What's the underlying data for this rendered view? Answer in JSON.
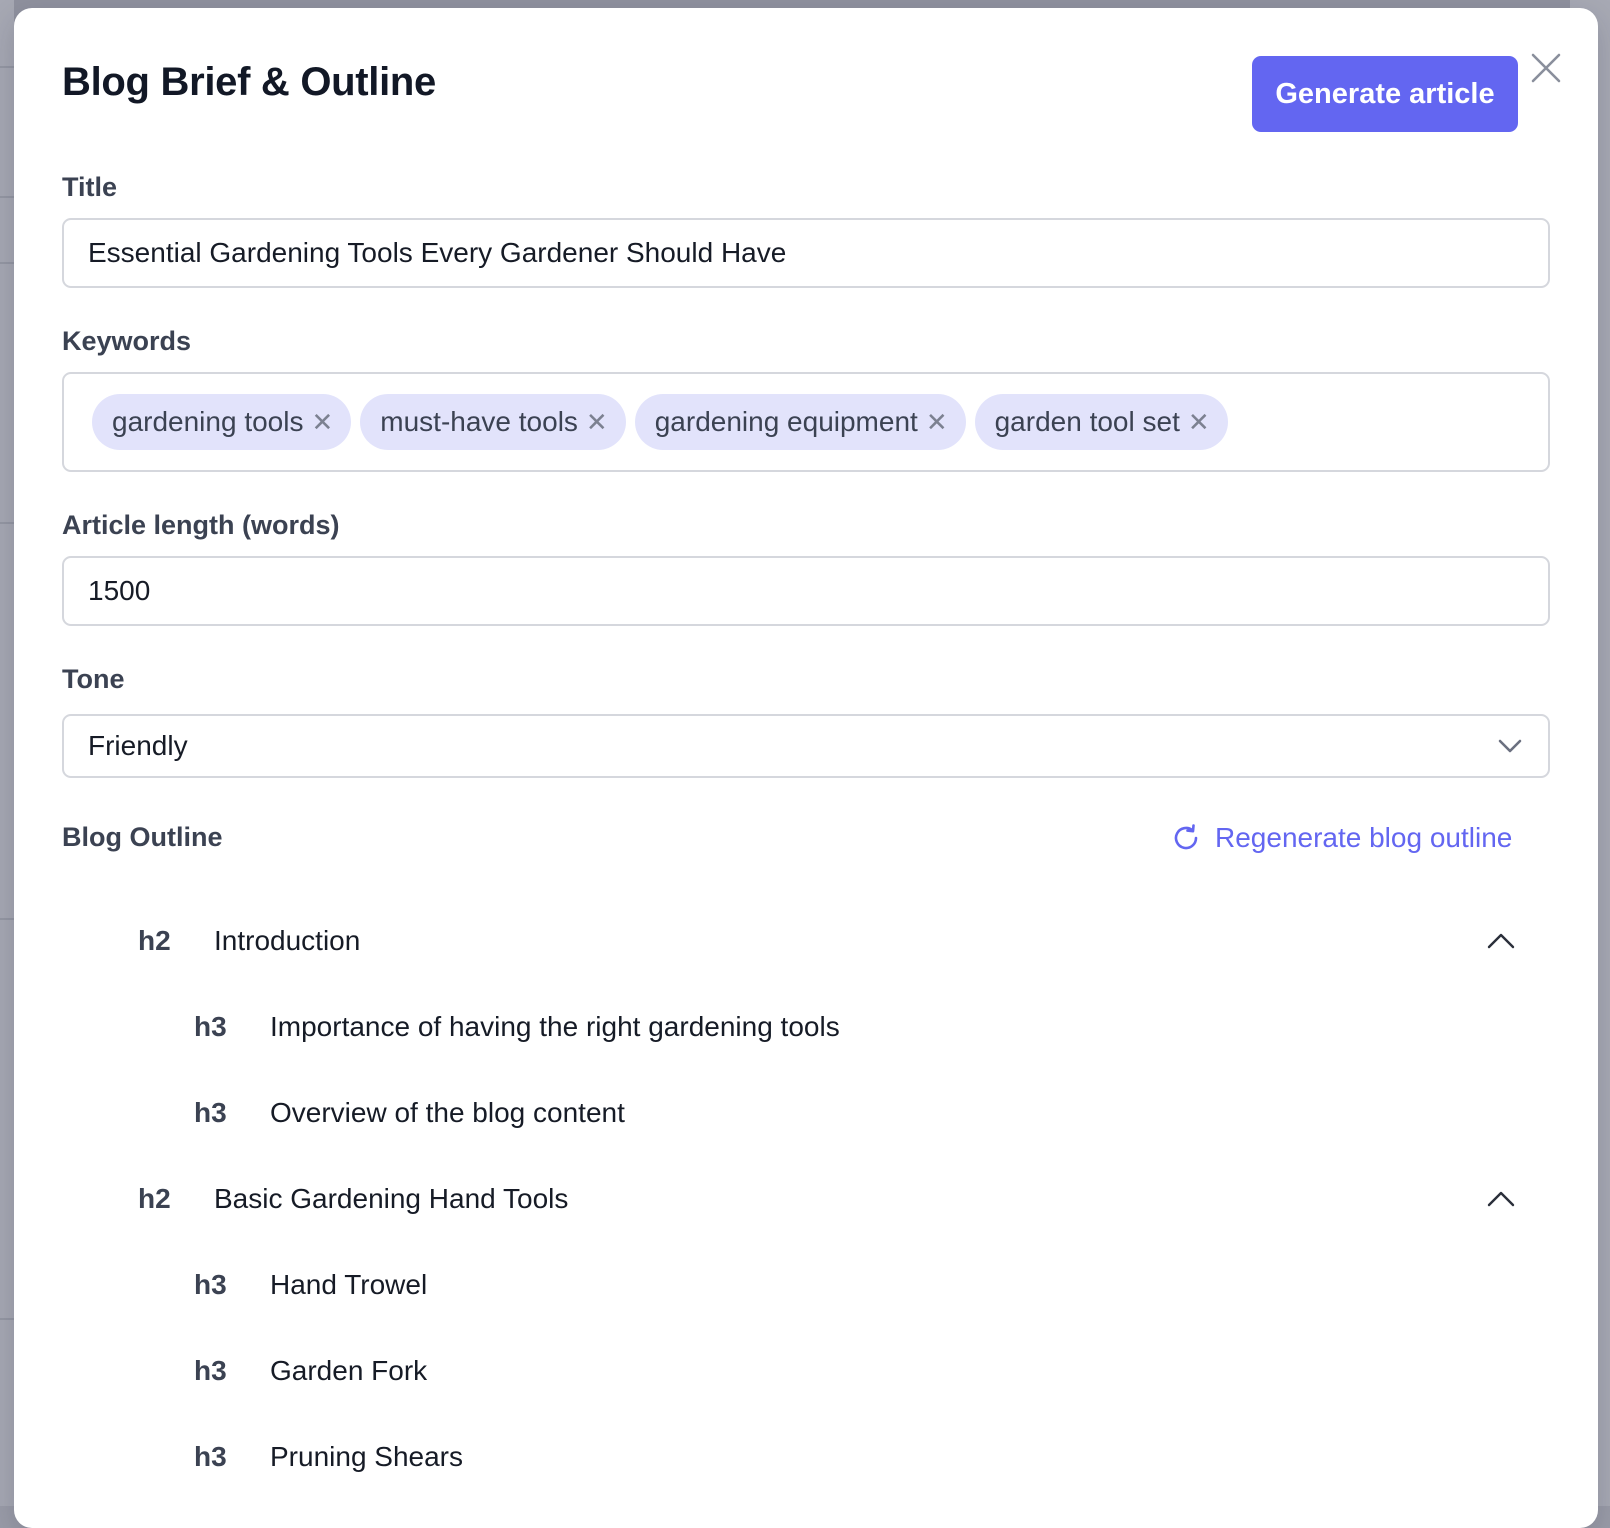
{
  "modal": {
    "title": "Blog Brief & Outline",
    "generate_label": "Generate article"
  },
  "fields": {
    "title_label": "Title",
    "title_value": "Essential Gardening Tools Every Gardener Should Have",
    "keywords_label": "Keywords",
    "keywords": [
      "gardening tools",
      "must-have tools",
      "gardening equipment",
      "garden tool set"
    ],
    "length_label": "Article length (words)",
    "length_value": "1500",
    "tone_label": "Tone",
    "tone_value": "Friendly"
  },
  "outline": {
    "label": "Blog Outline",
    "regenerate_label": "Regenerate blog outline",
    "items": [
      {
        "level": "h2",
        "text": "Introduction"
      },
      {
        "level": "h3",
        "text": "Importance of having the right gardening tools"
      },
      {
        "level": "h3",
        "text": "Overview of the blog content"
      },
      {
        "level": "h2",
        "text": "Basic Gardening Hand Tools"
      },
      {
        "level": "h3",
        "text": "Hand Trowel"
      },
      {
        "level": "h3",
        "text": "Garden Fork"
      },
      {
        "level": "h3",
        "text": "Pruning Shears"
      }
    ]
  },
  "icons": {
    "close": "close-icon",
    "remove_keyword": "remove-keyword-icon",
    "dropdown": "chevron-down-icon",
    "regenerate": "refresh-icon",
    "collapse": "chevron-up-icon"
  },
  "colors": {
    "accent": "#6366f1",
    "chip_bg": "#e2e3fb",
    "label": "#3b4252",
    "text": "#161b26",
    "border": "#d5d7dd"
  }
}
